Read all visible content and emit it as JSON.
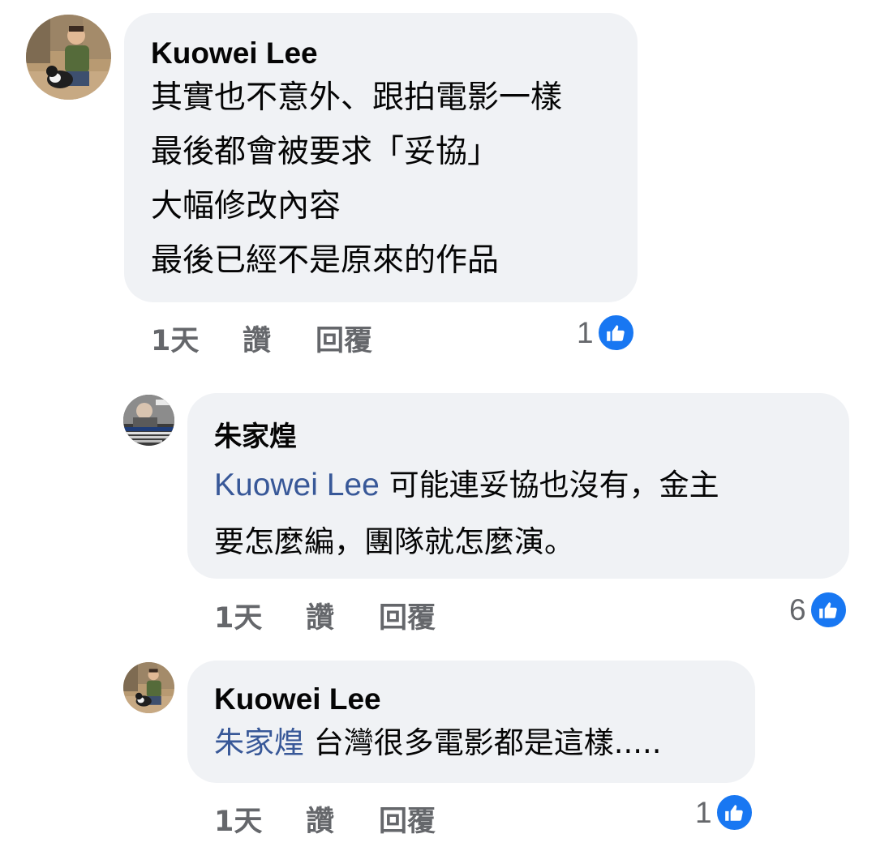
{
  "comments": [
    {
      "author": "Kuowei Lee",
      "lines": [
        "其實也不意外、跟拍電影一樣",
        "最後都會被要求「妥協」",
        "大幅修改內容",
        "最後已經不是原來的作品"
      ],
      "time": "1天",
      "like_label": "讚",
      "reply_label": "回覆",
      "reaction_count": "1",
      "avatar_icon": "person-with-dog-photo"
    },
    {
      "author": "朱家煌",
      "mention": "Kuowei Lee",
      "line1_rest": " 可能連妥協也沒有，金主",
      "line2": "要怎麼編，團隊就怎麼演。",
      "time": "1天",
      "like_label": "讚",
      "reply_label": "回覆",
      "reaction_count": "6",
      "avatar_icon": "news-broadcast-photo"
    },
    {
      "author": "Kuowei Lee",
      "mention": "朱家煌",
      "text": " 台灣很多電影都是這樣.....",
      "time": "1天",
      "like_label": "讚",
      "reply_label": "回覆",
      "reaction_count": "1",
      "avatar_icon": "person-with-dog-photo"
    }
  ],
  "colors": {
    "bubble": "#f0f2f5",
    "mention": "#385898",
    "meta": "#65676b",
    "like": "#1877f2"
  }
}
